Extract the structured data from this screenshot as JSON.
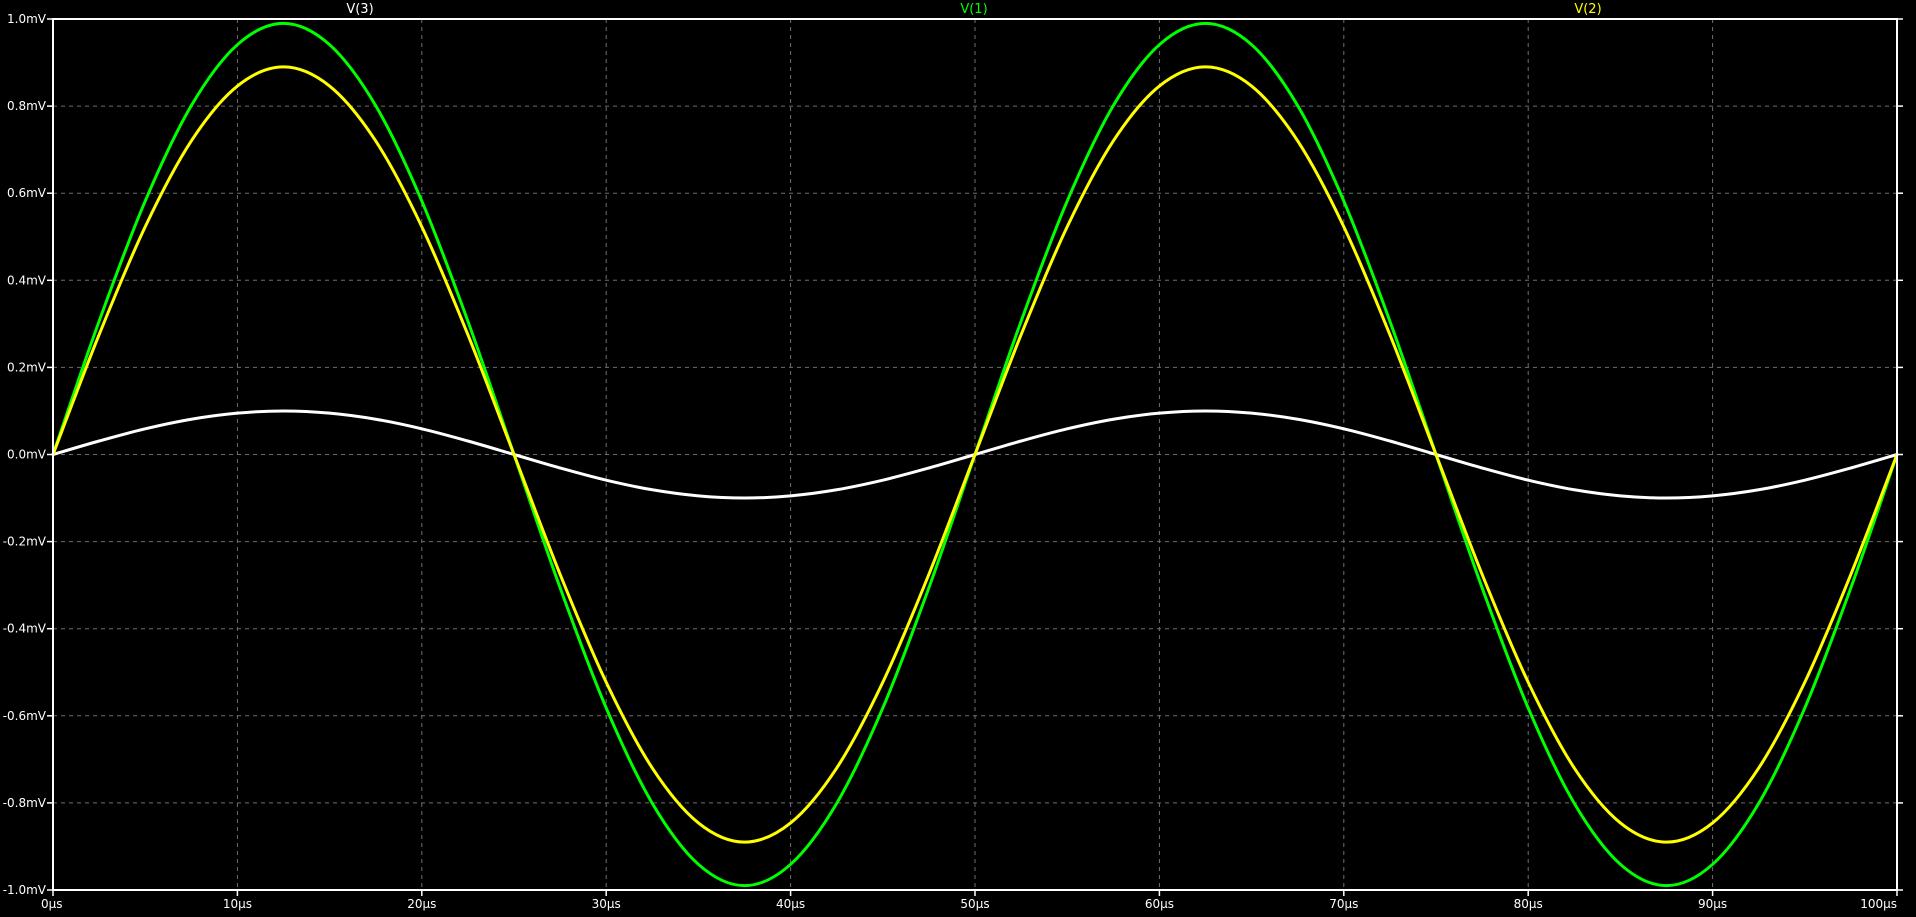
{
  "chart_data": {
    "type": "line",
    "title": "",
    "xlabel": "",
    "ylabel": "",
    "xlim": [
      0,
      100
    ],
    "ylim": [
      -1.0,
      1.0
    ],
    "x_unit": "µs",
    "y_unit": "mV",
    "grid": true,
    "legend_placement": "top",
    "x_ticks": [
      "0µs",
      "10µs",
      "20µs",
      "30µs",
      "40µs",
      "50µs",
      "60µs",
      "70µs",
      "80µs",
      "90µs",
      "100µs"
    ],
    "y_ticks": [
      "1.0mV",
      "0.8mV",
      "0.6mV",
      "0.4mV",
      "0.2mV",
      "0.0mV",
      "-0.2mV",
      "-0.4mV",
      "-0.6mV",
      "-0.8mV",
      "-1.0mV"
    ],
    "x_tick_values": [
      0,
      10,
      20,
      30,
      40,
      50,
      60,
      70,
      80,
      90,
      100
    ],
    "y_tick_values": [
      1.0,
      0.8,
      0.6,
      0.4,
      0.2,
      0.0,
      -0.2,
      -0.4,
      -0.6,
      -0.8,
      -1.0
    ],
    "series": [
      {
        "name": "V(3)",
        "color": "#ffffff",
        "x": [
          0,
          2.5,
          5,
          7.5,
          10,
          12.5,
          15,
          17.5,
          20,
          22.5,
          25,
          27.5,
          30,
          32.5,
          35,
          37.5,
          40,
          42.5,
          45,
          47.5,
          50,
          52.5,
          55,
          57.5,
          60,
          62.5,
          65,
          67.5,
          70,
          72.5,
          75,
          77.5,
          80,
          82.5,
          85,
          87.5,
          90,
          92.5,
          95,
          97.5,
          100
        ],
        "y": [
          0,
          0.031,
          0.059,
          0.081,
          0.095,
          0.1,
          0.095,
          0.081,
          0.059,
          0.031,
          0,
          -0.031,
          -0.059,
          -0.081,
          -0.095,
          -0.1,
          -0.095,
          -0.081,
          -0.059,
          -0.031,
          0,
          0.031,
          0.059,
          0.081,
          0.095,
          0.1,
          0.095,
          0.081,
          0.059,
          0.031,
          0,
          -0.031,
          -0.059,
          -0.081,
          -0.095,
          -0.1,
          -0.095,
          -0.081,
          -0.059,
          -0.031,
          0
        ]
      },
      {
        "name": "V(1)",
        "color": "#00ff00",
        "x": [
          0,
          2.5,
          5,
          7.5,
          10,
          12.5,
          15,
          17.5,
          20,
          22.5,
          25,
          27.5,
          30,
          32.5,
          35,
          37.5,
          40,
          42.5,
          45,
          47.5,
          50,
          52.5,
          55,
          57.5,
          60,
          62.5,
          65,
          67.5,
          70,
          72.5,
          75,
          77.5,
          80,
          82.5,
          85,
          87.5,
          90,
          92.5,
          95,
          97.5,
          100
        ],
        "y": [
          0,
          0.306,
          0.582,
          0.801,
          0.941,
          0.99,
          0.941,
          0.801,
          0.582,
          0.306,
          0,
          -0.306,
          -0.582,
          -0.801,
          -0.941,
          -0.99,
          -0.941,
          -0.801,
          -0.582,
          -0.306,
          0,
          0.306,
          0.582,
          0.801,
          0.941,
          0.99,
          0.941,
          0.801,
          0.582,
          0.306,
          0,
          -0.306,
          -0.582,
          -0.801,
          -0.941,
          -0.99,
          -0.941,
          -0.801,
          -0.582,
          -0.306,
          0
        ]
      },
      {
        "name": "V(2)",
        "color": "#ffff00",
        "x": [
          0,
          2.5,
          5,
          7.5,
          10,
          12.5,
          15,
          17.5,
          20,
          22.5,
          25,
          27.5,
          30,
          32.5,
          35,
          37.5,
          40,
          42.5,
          45,
          47.5,
          50,
          52.5,
          55,
          57.5,
          60,
          62.5,
          65,
          67.5,
          70,
          72.5,
          75,
          77.5,
          80,
          82.5,
          85,
          87.5,
          90,
          92.5,
          95,
          97.5,
          100
        ],
        "y": [
          0,
          0.275,
          0.523,
          0.72,
          0.846,
          0.89,
          0.846,
          0.72,
          0.523,
          0.275,
          0,
          -0.275,
          -0.523,
          -0.72,
          -0.846,
          -0.89,
          -0.846,
          -0.72,
          -0.523,
          -0.275,
          0,
          0.275,
          0.523,
          0.72,
          0.846,
          0.89,
          0.846,
          0.72,
          0.523,
          0.275,
          0,
          -0.275,
          -0.523,
          -0.72,
          -0.846,
          -0.89,
          -0.846,
          -0.72,
          -0.523,
          -0.275,
          0
        ]
      }
    ]
  }
}
